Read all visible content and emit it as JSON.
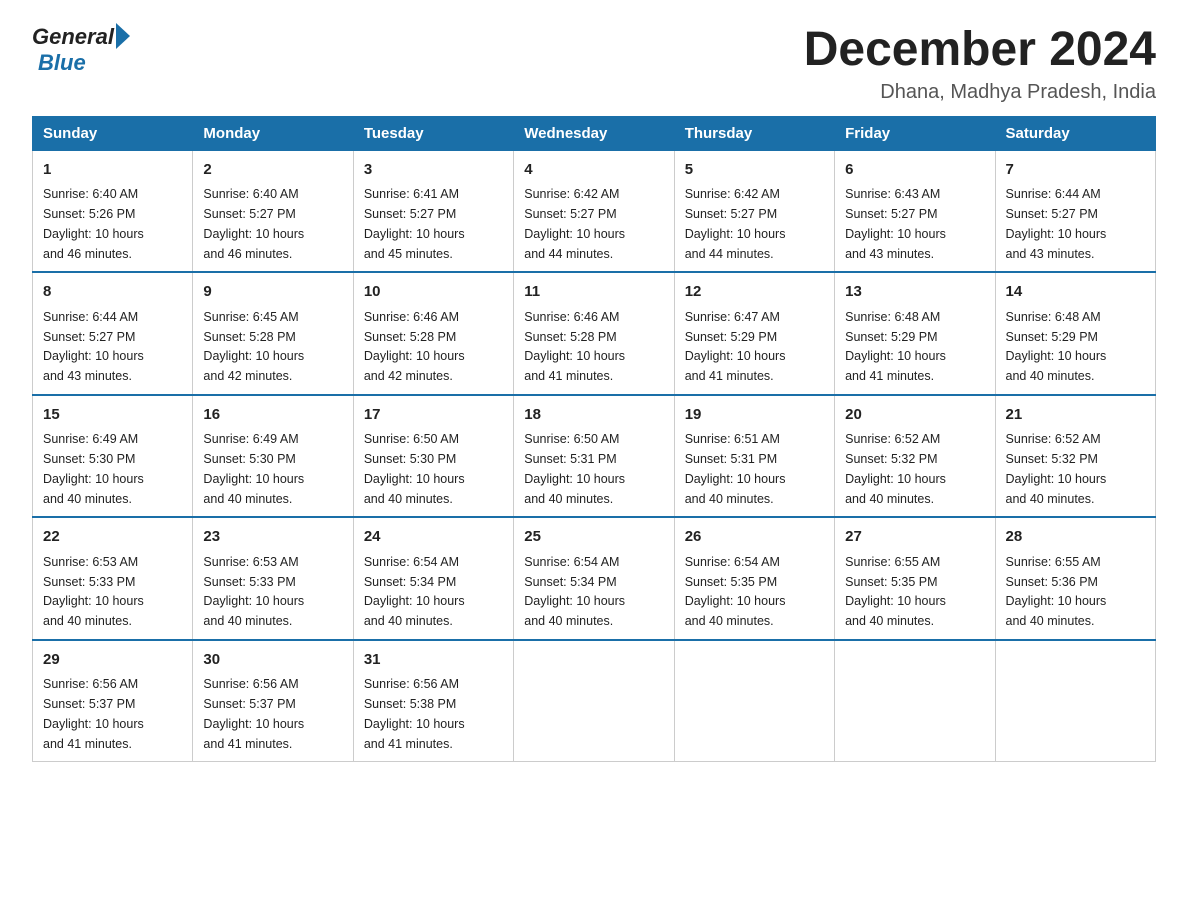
{
  "header": {
    "logo_general": "General",
    "logo_blue": "Blue",
    "title": "December 2024",
    "location": "Dhana, Madhya Pradesh, India"
  },
  "days_of_week": [
    "Sunday",
    "Monday",
    "Tuesday",
    "Wednesday",
    "Thursday",
    "Friday",
    "Saturday"
  ],
  "weeks": [
    [
      {
        "day": "1",
        "sunrise": "6:40 AM",
        "sunset": "5:26 PM",
        "daylight": "10 hours and 46 minutes."
      },
      {
        "day": "2",
        "sunrise": "6:40 AM",
        "sunset": "5:27 PM",
        "daylight": "10 hours and 46 minutes."
      },
      {
        "day": "3",
        "sunrise": "6:41 AM",
        "sunset": "5:27 PM",
        "daylight": "10 hours and 45 minutes."
      },
      {
        "day": "4",
        "sunrise": "6:42 AM",
        "sunset": "5:27 PM",
        "daylight": "10 hours and 44 minutes."
      },
      {
        "day": "5",
        "sunrise": "6:42 AM",
        "sunset": "5:27 PM",
        "daylight": "10 hours and 44 minutes."
      },
      {
        "day": "6",
        "sunrise": "6:43 AM",
        "sunset": "5:27 PM",
        "daylight": "10 hours and 43 minutes."
      },
      {
        "day": "7",
        "sunrise": "6:44 AM",
        "sunset": "5:27 PM",
        "daylight": "10 hours and 43 minutes."
      }
    ],
    [
      {
        "day": "8",
        "sunrise": "6:44 AM",
        "sunset": "5:27 PM",
        "daylight": "10 hours and 43 minutes."
      },
      {
        "day": "9",
        "sunrise": "6:45 AM",
        "sunset": "5:28 PM",
        "daylight": "10 hours and 42 minutes."
      },
      {
        "day": "10",
        "sunrise": "6:46 AM",
        "sunset": "5:28 PM",
        "daylight": "10 hours and 42 minutes."
      },
      {
        "day": "11",
        "sunrise": "6:46 AM",
        "sunset": "5:28 PM",
        "daylight": "10 hours and 41 minutes."
      },
      {
        "day": "12",
        "sunrise": "6:47 AM",
        "sunset": "5:29 PM",
        "daylight": "10 hours and 41 minutes."
      },
      {
        "day": "13",
        "sunrise": "6:48 AM",
        "sunset": "5:29 PM",
        "daylight": "10 hours and 41 minutes."
      },
      {
        "day": "14",
        "sunrise": "6:48 AM",
        "sunset": "5:29 PM",
        "daylight": "10 hours and 40 minutes."
      }
    ],
    [
      {
        "day": "15",
        "sunrise": "6:49 AM",
        "sunset": "5:30 PM",
        "daylight": "10 hours and 40 minutes."
      },
      {
        "day": "16",
        "sunrise": "6:49 AM",
        "sunset": "5:30 PM",
        "daylight": "10 hours and 40 minutes."
      },
      {
        "day": "17",
        "sunrise": "6:50 AM",
        "sunset": "5:30 PM",
        "daylight": "10 hours and 40 minutes."
      },
      {
        "day": "18",
        "sunrise": "6:50 AM",
        "sunset": "5:31 PM",
        "daylight": "10 hours and 40 minutes."
      },
      {
        "day": "19",
        "sunrise": "6:51 AM",
        "sunset": "5:31 PM",
        "daylight": "10 hours and 40 minutes."
      },
      {
        "day": "20",
        "sunrise": "6:52 AM",
        "sunset": "5:32 PM",
        "daylight": "10 hours and 40 minutes."
      },
      {
        "day": "21",
        "sunrise": "6:52 AM",
        "sunset": "5:32 PM",
        "daylight": "10 hours and 40 minutes."
      }
    ],
    [
      {
        "day": "22",
        "sunrise": "6:53 AM",
        "sunset": "5:33 PM",
        "daylight": "10 hours and 40 minutes."
      },
      {
        "day": "23",
        "sunrise": "6:53 AM",
        "sunset": "5:33 PM",
        "daylight": "10 hours and 40 minutes."
      },
      {
        "day": "24",
        "sunrise": "6:54 AM",
        "sunset": "5:34 PM",
        "daylight": "10 hours and 40 minutes."
      },
      {
        "day": "25",
        "sunrise": "6:54 AM",
        "sunset": "5:34 PM",
        "daylight": "10 hours and 40 minutes."
      },
      {
        "day": "26",
        "sunrise": "6:54 AM",
        "sunset": "5:35 PM",
        "daylight": "10 hours and 40 minutes."
      },
      {
        "day": "27",
        "sunrise": "6:55 AM",
        "sunset": "5:35 PM",
        "daylight": "10 hours and 40 minutes."
      },
      {
        "day": "28",
        "sunrise": "6:55 AM",
        "sunset": "5:36 PM",
        "daylight": "10 hours and 40 minutes."
      }
    ],
    [
      {
        "day": "29",
        "sunrise": "6:56 AM",
        "sunset": "5:37 PM",
        "daylight": "10 hours and 41 minutes."
      },
      {
        "day": "30",
        "sunrise": "6:56 AM",
        "sunset": "5:37 PM",
        "daylight": "10 hours and 41 minutes."
      },
      {
        "day": "31",
        "sunrise": "6:56 AM",
        "sunset": "5:38 PM",
        "daylight": "10 hours and 41 minutes."
      },
      null,
      null,
      null,
      null
    ]
  ],
  "labels": {
    "sunrise": "Sunrise:",
    "sunset": "Sunset:",
    "daylight": "Daylight:"
  }
}
